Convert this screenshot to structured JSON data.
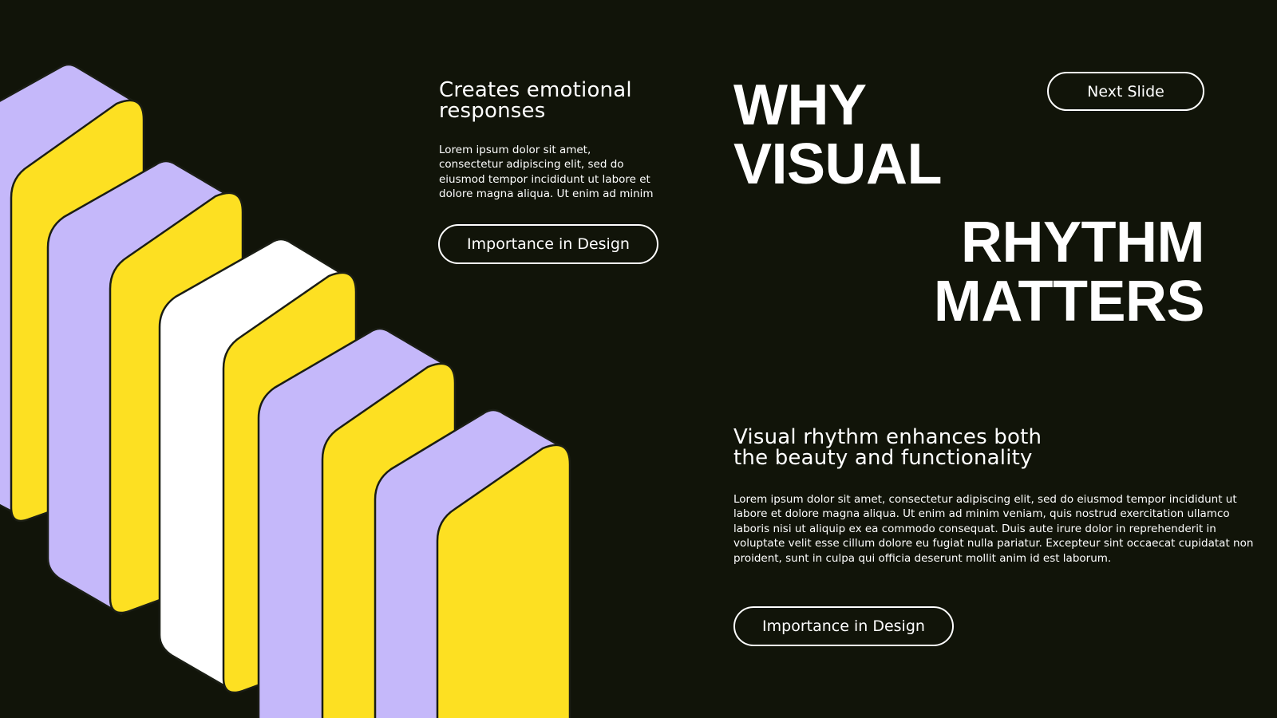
{
  "colors": {
    "background": "#111409",
    "lavender": "#c5b8fa",
    "yellow": "#fde022",
    "white": "#ffffff",
    "outline": "#1a1d14"
  },
  "top_block": {
    "subheading_line1": "Creates emotional",
    "subheading_line2": "responses",
    "body_line1": "Lorem ipsum dolor sit amet,",
    "body_line2": "consectetur adipiscing elit, sed do",
    "body_line3": "eiusmod tempor incididunt ut labore et",
    "body_line4": "dolore magna aliqua. Ut enim ad minim",
    "button_label": "Importance in Design"
  },
  "title": {
    "line1": "WHY",
    "line2": "VISUAL",
    "line3": "RHYTHM",
    "line4": "MATTERS"
  },
  "next_button_label": "Next Slide",
  "bottom_block": {
    "subheading_line1": "Visual rhythm enhances both",
    "subheading_line2": "the beauty and functionality",
    "body_line1": "Lorem ipsum dolor sit amet, consectetur adipiscing elit, sed do eiusmod tempor incididunt ut",
    "body_line2": "labore et dolore magna aliqua. Ut enim ad minim veniam, quis nostrud exercitation ullamco",
    "body_line3": "laboris nisi ut aliquip ex ea commodo consequat. Duis aute irure dolor in reprehenderit in",
    "body_line4": "voluptate velit esse cillum dolore eu fugiat nulla pariatur. Excepteur sint occaecat cupidatat non",
    "body_line5": "proident, sunt in culpa qui officia deserunt mollit anim id est laborum.",
    "button_label": "Importance in Design"
  }
}
